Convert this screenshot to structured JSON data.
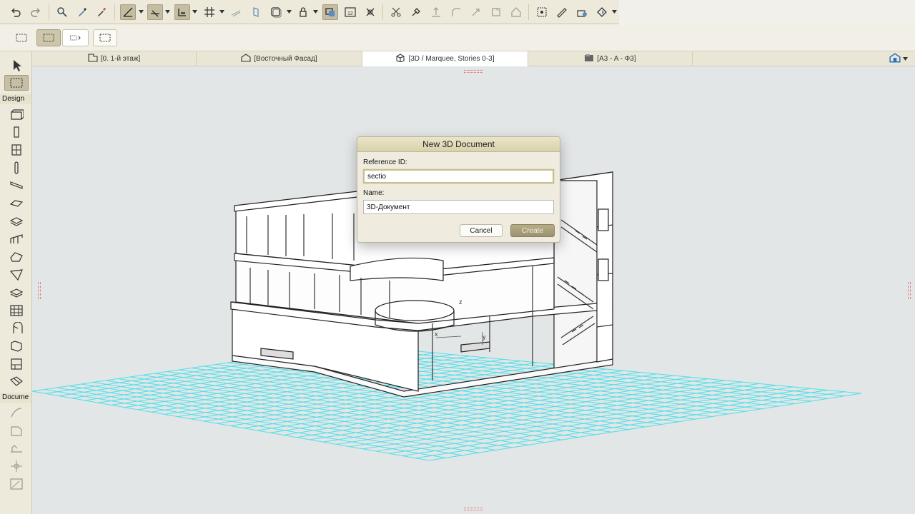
{
  "toolbar": {
    "undo_icon": "undo-icon",
    "redo_icon": "redo-icon",
    "tools": [
      "info-icon",
      "eyedropper-icon",
      "syringe-icon",
      "guide-line-icon",
      "snap-guide-icon",
      "grid-snap-icon",
      "grid-icon",
      "relative-construction-icon",
      "surface-paint-icon",
      "layer-icon",
      "lock-icon",
      "trace-reference-icon",
      "dimension-icon",
      "move-icon",
      "cut-icon",
      "adjust-icon",
      "offset-icon",
      "fillet-icon",
      "rotate-icon",
      "split-icon",
      "group-icon",
      "magic-wand-icon",
      "view-cube-icon",
      "render-icon"
    ]
  },
  "tabs": [
    {
      "label": "[0. 1-й этаж]",
      "icon": "floor-plan-icon"
    },
    {
      "label": "[Восточный Фасад]",
      "icon": "elevation-icon"
    },
    {
      "label": "[3D / Marquee, Stories 0-3]",
      "icon": "cube-3d-icon",
      "active": true
    },
    {
      "label": "[A3 - A - Ф3]",
      "icon": "layout-icon"
    }
  ],
  "toolbox": {
    "design_heading": "Design",
    "document_heading": "Docume",
    "design_tools": [
      "wall-tool-icon",
      "column-tool-icon",
      "window-tool-icon",
      "beam-tool-icon",
      "slab-tool-icon",
      "roof-tool-icon",
      "stair-tool-icon",
      "shell-tool-icon",
      "mesh-tool-icon",
      "railing-tool-icon",
      "curtain-wall-tool-icon",
      "morph-tool-icon",
      "object-tool-icon",
      "zone-tool-icon",
      "lamp-tool-icon"
    ],
    "document_tools": [
      "dimension-tool-icon",
      "label-tool-icon",
      "level-tool-icon",
      "section-tool-icon",
      "drawing-tool-icon"
    ]
  },
  "dialog": {
    "title": "New 3D Document",
    "reference_label": "Reference ID:",
    "reference_value": "sectio",
    "name_label": "Name:",
    "name_value": "3D-Документ",
    "cancel_label": "Cancel",
    "create_label": "Create"
  },
  "colors": {
    "accent": "#b8ad86",
    "grid": "#4de0e8",
    "toolbar": "#eeeadb"
  }
}
